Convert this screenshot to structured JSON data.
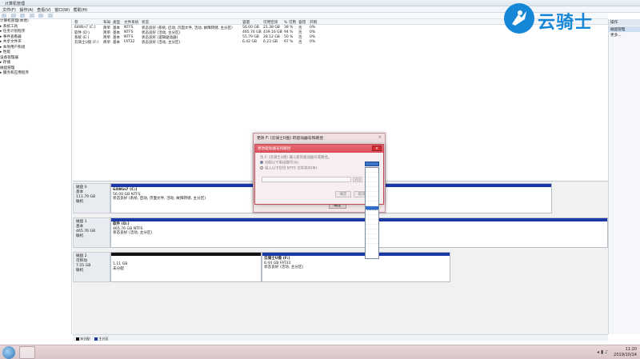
{
  "window": {
    "title": "计算机管理",
    "menu": [
      "文件(F)",
      "操作(A)",
      "查看(V)",
      "窗口(W)",
      "帮助(H)"
    ]
  },
  "tree": {
    "items": [
      "计算机管理(本地)",
      "▸ 系统工具",
      "  ▸ 任务计划程序",
      "  ▸ 事件查看器",
      "  ▸ 共享文件夹",
      "  ▸ 本地用户和组",
      "  ▸ 性能",
      "    设备管理器",
      "▸ 存储",
      "    磁盘管理",
      "▸ 服务和应用程序"
    ]
  },
  "volumes": {
    "headers": [
      "卷",
      "布局",
      "类型",
      "文件系统",
      "状态",
      "容量",
      "可用空间",
      "% 可用",
      "容错",
      "开销"
    ],
    "rows": [
      {
        "vol": "64Win7 (C:)",
        "layout": "简单",
        "type": "基本",
        "fs": "NTFS",
        "status": "状态良好 (系统, 启动, 页面文件, 活动, 故障转储, 主分区)",
        "cap": "56.00 GB",
        "free": "21.38 GB",
        "pct": "38 %",
        "ft": "否",
        "ov": "0%"
      },
      {
        "vol": "软件 (D:)",
        "layout": "简单",
        "type": "基本",
        "fs": "NTFS",
        "status": "状态良好 (活动, 主分区)",
        "cap": "465.76 GB",
        "free": "439.16 GB",
        "pct": "94 %",
        "ft": "否",
        "ov": "0%"
      },
      {
        "vol": "系统 (E:)",
        "layout": "简单",
        "type": "基本",
        "fs": "NTFS",
        "status": "状态良好 (逻辑驱动器)",
        "cap": "55.79 GB",
        "free": "28.12 GB",
        "pct": "50 %",
        "ft": "否",
        "ov": "0%"
      },
      {
        "vol": "云骑士U盘 (F:)",
        "layout": "简单",
        "type": "基本",
        "fs": "FAT32",
        "status": "状态良好 (活动, 主分区)",
        "cap": "6.42 GB",
        "free": "6.23 GB",
        "pct": "97 %",
        "ft": "否",
        "ov": "0%"
      }
    ]
  },
  "disks": [
    {
      "name": "磁盘 0",
      "kind": "基本",
      "size": "111.79 GB",
      "state": "联机",
      "parts": [
        {
          "label": "64Win7 (C:)",
          "detail": "56.00 GB NTFS",
          "status": "状态良好 (系统, 启动, 页面文件, 活动, 故障转储, 主分区)"
        }
      ]
    },
    {
      "name": "磁盘 1",
      "kind": "基本",
      "size": "465.76 GB",
      "state": "联机",
      "parts": [
        {
          "label": "软件 (D:)",
          "detail": "465.76 GB NTFS",
          "status": "状态良好 (活动, 主分区)"
        }
      ]
    },
    {
      "name": "磁盘 2",
      "kind": "可移动",
      "size": "7.55 GB",
      "state": "联机",
      "parts": [
        {
          "label": "",
          "detail": "1.11 GB",
          "status": "未分配"
        },
        {
          "label": "云骑士U盘 (F:)",
          "detail": "6.44 GB FAT32",
          "status": "状态良好 (活动, 主分区)"
        }
      ]
    }
  ],
  "legend": [
    "未分配",
    "主分区"
  ],
  "actions": {
    "header": "操作",
    "selected": "磁盘管理",
    "more": "更多..."
  },
  "dialog_outer": {
    "title": "更改 F: (云骑士U盘) 的驱动器号和路径",
    "close": "×",
    "ok": "确定"
  },
  "dialog_inner": {
    "title": "更改驱动器号和路径",
    "line1": "为 F: (云骑士U盘) 输入新的驱动器号或路径。",
    "opt1": "分配以下驱动器号(A):",
    "opt2": "装入以下空白 NTFS 文件夹中(M):",
    "browse": "浏览",
    "ok": "确定",
    "cancel": "取消",
    "close": "×"
  },
  "watermark": {
    "text": "云骑士"
  },
  "clock": {
    "time": "11:20",
    "date": "2019/10/14"
  }
}
